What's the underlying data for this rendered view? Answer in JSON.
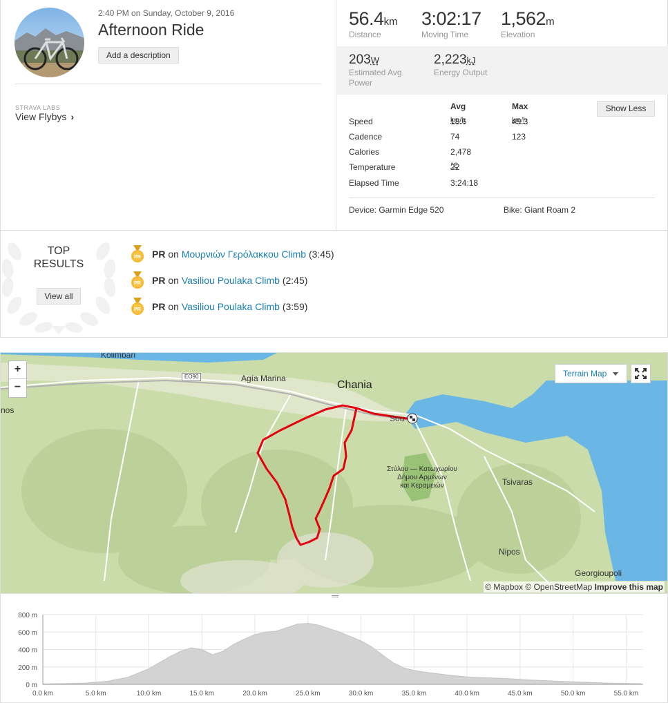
{
  "activity": {
    "datetime": "2:40 PM on Sunday, October 9, 2016",
    "title": "Afternoon Ride",
    "add_description": "Add a description",
    "labs_label": "STRAVA LABS",
    "flybys": "View Flybys"
  },
  "stats": {
    "distance": {
      "value": "56.4",
      "unit": "km",
      "label": "Distance"
    },
    "moving_time": {
      "value": "3:02:17",
      "label": "Moving Time"
    },
    "elevation": {
      "value": "1,562",
      "unit": "m",
      "label": "Elevation"
    },
    "power": {
      "value": "203",
      "unit": "W",
      "label1": "Estimated Avg",
      "label2": "Power"
    },
    "energy": {
      "value": "2,223",
      "unit": "kJ",
      "label": "Energy Output"
    },
    "show_less": "Show Less",
    "table": {
      "col_avg": "Avg",
      "col_max": "Max",
      "rows": [
        {
          "label": "Speed",
          "avg": "18.6",
          "avg_unit": "km/h",
          "max": "49.3",
          "max_unit": "km/h"
        },
        {
          "label": "Cadence",
          "avg": "74",
          "avg_unit": "",
          "max": "123",
          "max_unit": ""
        },
        {
          "label": "Calories",
          "avg": "2,478",
          "avg_unit": "",
          "max": "",
          "max_unit": ""
        },
        {
          "label": "Temperature",
          "avg": "22",
          "avg_unit": "℃",
          "max": "",
          "max_unit": ""
        },
        {
          "label": "Elapsed Time",
          "avg": "3:24:18",
          "avg_unit": "",
          "max": "",
          "max_unit": ""
        }
      ]
    },
    "device": "Device: Garmin Edge 520",
    "bike": "Bike: Giant Roam 2"
  },
  "top_results": {
    "title_line1": "TOP",
    "title_line2": "RESULTS",
    "view_all": "View all",
    "items": [
      {
        "badge": "PR",
        "prefix": "PR",
        "on": "on",
        "segment": "Μουρνιών Γερόλακκου Climb",
        "time": "(3:45)"
      },
      {
        "badge": "PR",
        "prefix": "PR",
        "on": "on",
        "segment": "Vasiliou Poulaka Climb",
        "time": "(2:45)"
      },
      {
        "badge": "PR",
        "prefix": "PR",
        "on": "on",
        "segment": "Vasiliou Poulaka Climb",
        "time": "(3:59)"
      }
    ]
  },
  "map": {
    "zoom_in": "+",
    "zoom_out": "−",
    "map_type": "Terrain Map",
    "labels": {
      "kolimbari": "Kolimbari",
      "nos": "nos",
      "road": "EO90",
      "agia_marina": "Agía Marina",
      "chania": "Chania",
      "souda": "Sou",
      "park1": "Στύλου — Κατωχωρίου",
      "park2": "Δήμου Αρμένων",
      "park3": "και Κεραμειών",
      "tsivaras": "Tsivaras",
      "nipos": "Nipos",
      "georgioupoli": "Georgioupoli"
    },
    "attribution": {
      "mapbox": "© Mapbox",
      "osm": "© OpenStreetMap",
      "improve": "Improve this map"
    },
    "colors": {
      "route": "#e3000f",
      "sea": "#6ab7e6",
      "land": "#c9dca9"
    }
  },
  "chart_data": {
    "type": "area",
    "xlabel": "",
    "ylabel": "",
    "x_unit": "km",
    "y_unit": "m",
    "xlim": [
      0,
      56.4
    ],
    "ylim": [
      0,
      800
    ],
    "x_ticks": [
      "0.0 km",
      "5.0 km",
      "10.0 km",
      "15.0 km",
      "20.0 km",
      "25.0 km",
      "30.0 km",
      "35.0 km",
      "40.0 km",
      "45.0 km",
      "50.0 km",
      "55.0 km"
    ],
    "y_ticks": [
      "0 m",
      "200 m",
      "400 m",
      "600 m",
      "800 m"
    ],
    "x": [
      0,
      2,
      4,
      6,
      8,
      10,
      11,
      12,
      13,
      14,
      15,
      16,
      17,
      18,
      19,
      20,
      21,
      22,
      23,
      24,
      25,
      26,
      27,
      28,
      29,
      30,
      31,
      32,
      33,
      34,
      35,
      36,
      38,
      40,
      42,
      44,
      46,
      48,
      50,
      52,
      54,
      56.4
    ],
    "values": [
      5,
      8,
      15,
      35,
      80,
      180,
      250,
      320,
      380,
      420,
      400,
      340,
      380,
      460,
      520,
      570,
      600,
      610,
      650,
      690,
      700,
      680,
      640,
      600,
      550,
      500,
      430,
      340,
      250,
      190,
      160,
      140,
      110,
      85,
      75,
      65,
      50,
      40,
      30,
      20,
      12,
      8
    ],
    "fill_color": "#d3d3d3",
    "grid": true
  }
}
